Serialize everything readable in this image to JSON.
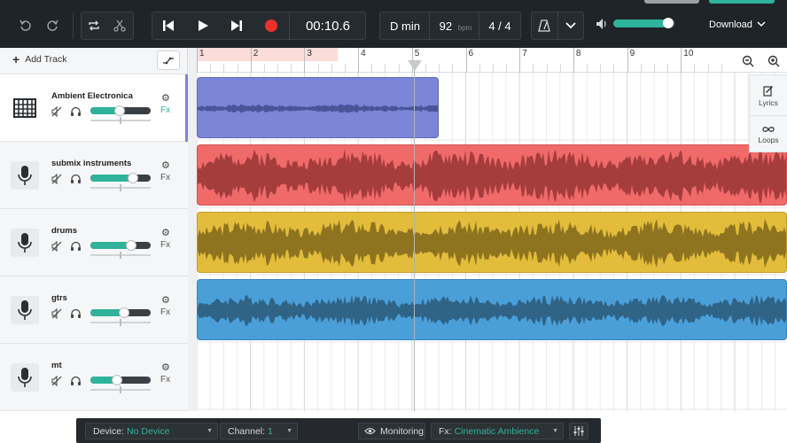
{
  "toolbar": {
    "time": "00:10.6",
    "key": "D min",
    "bpm": "92",
    "bpm_unit": "bpm",
    "signature": "4 / 4",
    "download": "Download"
  },
  "panel": {
    "add_track": "Add Track"
  },
  "ruler": [
    "1",
    "2",
    "3",
    "4",
    "5",
    "6",
    "7",
    "8",
    "9",
    "10"
  ],
  "tracks": [
    {
      "name": "Ambient Electronica",
      "fx": "Fx",
      "volume": 0.48
    },
    {
      "name": "submix instruments",
      "fx": "Fx",
      "volume": 0.7
    },
    {
      "name": "drums",
      "fx": "Fx",
      "volume": 0.68
    },
    {
      "name": "gtrs",
      "fx": "Fx",
      "volume": 0.56
    },
    {
      "name": "mt",
      "fx": "Fx",
      "volume": 0.44
    }
  ],
  "side": {
    "lyrics": "Lyrics",
    "loops": "Loops"
  },
  "bottom": {
    "device_label": "Device:",
    "device_value": "No Device",
    "channel_label": "Channel:",
    "channel_value": "1",
    "monitoring": "Monitoring",
    "fx_label": "Fx:",
    "fx_value": "Cinematic Ambience"
  },
  "colors": {
    "accent": "#2fb39a",
    "clip_purple": "#7b86d8",
    "clip_red": "#f06a6a",
    "clip_yellow": "#e2bc3a",
    "clip_blue": "#4b9fd9",
    "record": "#e8322b"
  }
}
